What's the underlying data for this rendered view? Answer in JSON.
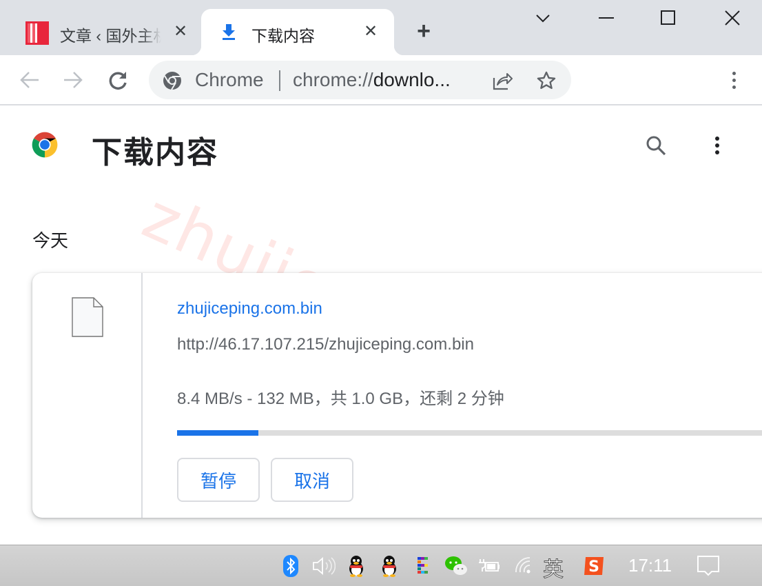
{
  "browser": {
    "tabs": [
      {
        "title": "文章 ‹ 国外主机",
        "favicon": "site-logo-icon",
        "active": false
      },
      {
        "title": "下载内容",
        "favicon": "download-icon",
        "active": true
      }
    ],
    "new_tab_label": "+",
    "window_controls": [
      "tab-search-icon",
      "minimize-icon",
      "maximize-icon",
      "close-icon"
    ]
  },
  "toolbar": {
    "chip_label": "Chrome",
    "url_scheme": "chrome://",
    "url_host": "downlo...",
    "icons": [
      "back-icon",
      "forward-icon",
      "reload-icon",
      "share-icon",
      "bookmark-star-icon",
      "menu-icon"
    ]
  },
  "page": {
    "title": "下载内容",
    "section_date": "今天",
    "watermark": "zhujiceping.com",
    "download": {
      "file_name": "zhujiceping.com.bin",
      "url": "http://46.17.107.215/zhujiceping.com.bin",
      "status": "8.4 MB/s - 132 MB，共 1.0 GB，还剩 2 分钟",
      "progress_fraction": 0.13,
      "buttons": {
        "pause": "暂停",
        "cancel": "取消"
      }
    }
  },
  "taskbar": {
    "tray_icons": [
      "bluetooth-icon",
      "volume-icon",
      "qq-icon",
      "qq-icon",
      "app-grid-icon",
      "wechat-icon",
      "power-icon",
      "wifi-icon",
      "ime-indicator",
      "sogou-icon",
      "notification-icon"
    ],
    "ime_label": "英",
    "clock": "17:11"
  },
  "colors": {
    "accent": "#1a73e8",
    "tabstrip_bg": "#dee1e6",
    "progress_track": "#dddddd",
    "watermark": "#f44336"
  }
}
